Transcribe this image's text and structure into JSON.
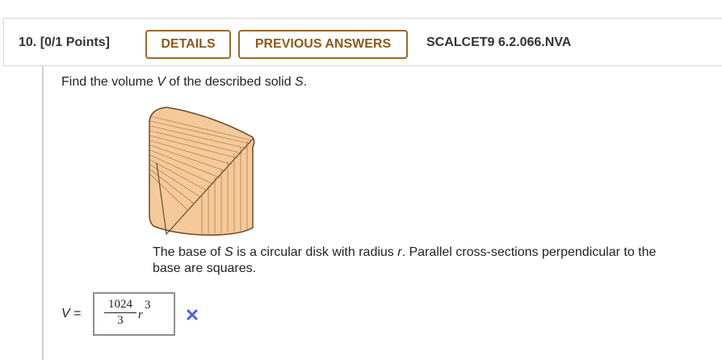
{
  "question": {
    "number_label": "10.",
    "points_label": "[0/1 Points]",
    "details_button": "DETAILS",
    "previous_answers_button": "PREVIOUS ANSWERS",
    "problem_code": "SCALCET9 6.2.066.NVA"
  },
  "prompt": {
    "pre": "Find the volume ",
    "var_v": "V",
    "mid": " of the described solid ",
    "var_s": "S",
    "post": "."
  },
  "description": {
    "pre": "The base of ",
    "var_s": "S",
    "mid": " is a circular disk with radius ",
    "var_r": "r",
    "post": ". Parallel cross-sections perpendicular to the base are squares."
  },
  "answer": {
    "label_var": "V",
    "label_eq": " =",
    "numerator": "1024",
    "denominator": "3",
    "variable": "r",
    "exponent": "3",
    "status": "incorrect"
  },
  "colors": {
    "accent_brown": "#9a6a2a",
    "solid_fill": "#f5c99a",
    "incorrect_mark": "#4a5ee0"
  }
}
